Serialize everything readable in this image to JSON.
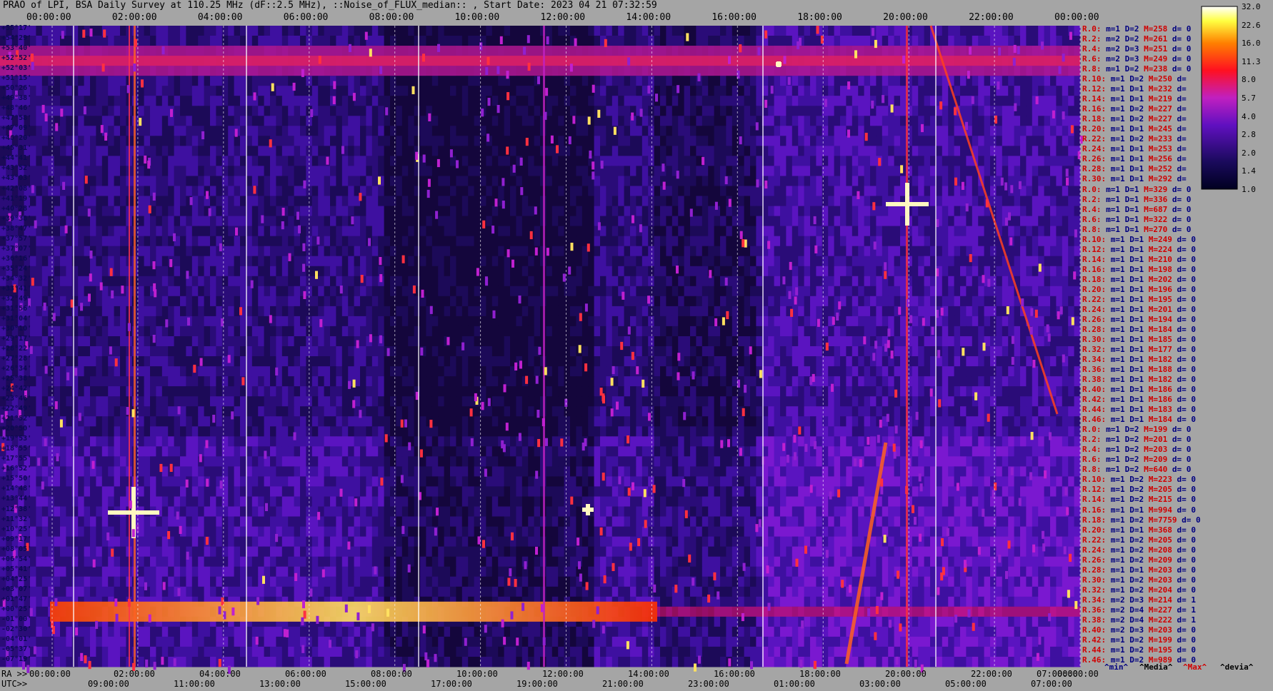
{
  "chart_data": {
    "type": "heatmap",
    "title": "PRAO of LPI, BSA Daily Survey at 110.25 MHz (dF::2.5 MHz), ::Noise_of_FLUX_median:: , Start Date: 2023 04 21 07:32:59",
    "colorbar": {
      "ticks": [
        "32.0",
        "22.6",
        "16.0",
        "11.3",
        "8.0",
        "5.7",
        "4.0",
        "2.8",
        "2.0",
        "1.4",
        "1.0"
      ],
      "range": [
        1.0,
        32.0
      ],
      "scale": "log"
    },
    "x_top_ticks": [
      "00:00:00",
      "02:00:00",
      "04:00:00",
      "06:00:00",
      "08:00:00",
      "10:00:00",
      "12:00:00",
      "14:00:00",
      "16:00:00",
      "18:00:00",
      "20:00:00",
      "22:00:00",
      "00:00:00"
    ],
    "x_bottom_ra_ticks": [
      "00:00:00",
      "02:00:00",
      "04:00:00",
      "06:00:00",
      "08:00:00",
      "10:00:00",
      "12:00:00",
      "14:00:00",
      "16:00:00",
      "18:00:00",
      "20:00:00",
      "22:00:00",
      "07:00:00",
      "00:00:00"
    ],
    "x_bottom_utc_ticks": [
      "09:00:00",
      "11:00:00",
      "13:00:00",
      "15:00:00",
      "17:00:00",
      "19:00:00",
      "21:00:00",
      "23:00:00",
      "01:00:00",
      "03:00:00",
      "05:00:00",
      "07:00:00"
    ],
    "x_bottom_ra_prefix": "RA >>",
    "x_bottom_utc_prefix": "UTC>>",
    "y_ticks": [
      "+55°17'",
      "+54°29'",
      "+53°40'",
      "+52°52'",
      "+52°03'",
      "+51°15'",
      "+50°26'",
      "+49°38'",
      "+48°46'",
      "+47°58'",
      "+47°09'",
      "+46°20'",
      "+45°31'",
      "+44°41'",
      "+43°52'",
      "+43°03'",
      "+42°08'",
      "+41°19'",
      "+40°28'",
      "+39°38'",
      "+38°47'",
      "+37°57'",
      "+37°07'",
      "+36°16'",
      "+35°24'",
      "+34°32'",
      "+33°41'",
      "+32°49'",
      "+31°56'",
      "+31°04'",
      "+30°10'",
      "+29°17'",
      "+28°22'",
      "+27°28'",
      "+26°34'",
      "+25°38'",
      "+24°42'",
      "+23°46'",
      "+22°49'",
      "+21°52'",
      "+20°50'",
      "+19°53'",
      "+18°55'",
      "+17°55'",
      "+16°52'",
      "+15°50'",
      "+14°48'",
      "+13°44'",
      "+12°38'",
      "+11°32'",
      "+10°25'",
      "+09°17'",
      "+08°05'",
      "+06°54'",
      "+05°41'",
      "+04°25'",
      "+03°07'",
      "+01°47'",
      "+00°25'",
      "-01°00'",
      "-02°30'",
      "-04°01'",
      "-05°37'",
      "-07°19'"
    ],
    "row_stats": [
      [
        "R.0:",
        "m=1",
        "D=2",
        "M=258",
        "d= 0"
      ],
      [
        "R.2:",
        "m=2",
        "D=2",
        "M=261",
        "d= 0"
      ],
      [
        "R.4:",
        "m=2",
        "D=3",
        "M=251",
        "d= 0"
      ],
      [
        "R.6:",
        "m=2",
        "D=3",
        "M=249",
        "d= 0"
      ],
      [
        "R.8:",
        "m=1",
        "D=2",
        "M=238",
        "d= 0"
      ],
      [
        "R.10:",
        "m=1",
        "D=2",
        "M=250",
        "d="
      ],
      [
        "R.12:",
        "m=1",
        "D=1",
        "M=232",
        "d="
      ],
      [
        "R.14:",
        "m=1",
        "D=1",
        "M=219",
        "d="
      ],
      [
        "R.16:",
        "m=1",
        "D=2",
        "M=227",
        "d="
      ],
      [
        "R.18:",
        "m=1",
        "D=2",
        "M=227",
        "d="
      ],
      [
        "R.20:",
        "m=1",
        "D=1",
        "M=245",
        "d="
      ],
      [
        "R.22:",
        "m=1",
        "D=2",
        "M=233",
        "d="
      ],
      [
        "R.24:",
        "m=1",
        "D=1",
        "M=253",
        "d="
      ],
      [
        "R.26:",
        "m=1",
        "D=1",
        "M=256",
        "d="
      ],
      [
        "R.28:",
        "m=1",
        "D=1",
        "M=252",
        "d="
      ],
      [
        "R.30:",
        "m=1",
        "D=1",
        "M=292",
        "d="
      ],
      [
        "R.0:",
        "m=1",
        "D=1",
        "M=329",
        "d= 0"
      ],
      [
        "R.2:",
        "m=1",
        "D=1",
        "M=336",
        "d= 0"
      ],
      [
        "R.4:",
        "m=1",
        "D=1",
        "M=687",
        "d= 0"
      ],
      [
        "R.6:",
        "m=1",
        "D=1",
        "M=322",
        "d= 0"
      ],
      [
        "R.8:",
        "m=1",
        "D=1",
        "M=270",
        "d= 0"
      ],
      [
        "R.10:",
        "m=1",
        "D=1",
        "M=249",
        "d= 0"
      ],
      [
        "R.12:",
        "m=1",
        "D=1",
        "M=224",
        "d= 0"
      ],
      [
        "R.14:",
        "m=1",
        "D=1",
        "M=210",
        "d= 0"
      ],
      [
        "R.16:",
        "m=1",
        "D=1",
        "M=198",
        "d= 0"
      ],
      [
        "R.18:",
        "m=1",
        "D=1",
        "M=202",
        "d= 0"
      ],
      [
        "R.20:",
        "m=1",
        "D=1",
        "M=196",
        "d= 0"
      ],
      [
        "R.22:",
        "m=1",
        "D=1",
        "M=195",
        "d= 0"
      ],
      [
        "R.24:",
        "m=1",
        "D=1",
        "M=201",
        "d= 0"
      ],
      [
        "R.26:",
        "m=1",
        "D=1",
        "M=194",
        "d= 0"
      ],
      [
        "R.28:",
        "m=1",
        "D=1",
        "M=184",
        "d= 0"
      ],
      [
        "R.30:",
        "m=1",
        "D=1",
        "M=185",
        "d= 0"
      ],
      [
        "R.32:",
        "m=1",
        "D=1",
        "M=177",
        "d= 0"
      ],
      [
        "R.34:",
        "m=1",
        "D=1",
        "M=182",
        "d= 0"
      ],
      [
        "R.36:",
        "m=1",
        "D=1",
        "M=188",
        "d= 0"
      ],
      [
        "R.38:",
        "m=1",
        "D=1",
        "M=182",
        "d= 0"
      ],
      [
        "R.40:",
        "m=1",
        "D=1",
        "M=186",
        "d= 0"
      ],
      [
        "R.42:",
        "m=1",
        "D=1",
        "M=186",
        "d= 0"
      ],
      [
        "R.44:",
        "m=1",
        "D=1",
        "M=183",
        "d= 0"
      ],
      [
        "R.46:",
        "m=1",
        "D=1",
        "M=184",
        "d= 0"
      ],
      [
        "R.0:",
        "m=1",
        "D=2",
        "M=199",
        "d= 0"
      ],
      [
        "R.2:",
        "m=1",
        "D=2",
        "M=201",
        "d= 0"
      ],
      [
        "R.4:",
        "m=1",
        "D=2",
        "M=203",
        "d= 0"
      ],
      [
        "R.6:",
        "m=1",
        "D=2",
        "M=209",
        "d= 0"
      ],
      [
        "R.8:",
        "m=1",
        "D=2",
        "M=640",
        "d= 0"
      ],
      [
        "R.10:",
        "m=1",
        "D=2",
        "M=223",
        "d= 0"
      ],
      [
        "R.12:",
        "m=1",
        "D=2",
        "M=205",
        "d= 0"
      ],
      [
        "R.14:",
        "m=1",
        "D=2",
        "M=215",
        "d= 0"
      ],
      [
        "R.16:",
        "m=1",
        "D=1",
        "M=994",
        "d= 0"
      ],
      [
        "R.18:",
        "m=1",
        "D=2",
        "M=7759",
        "d= 0"
      ],
      [
        "R.20:",
        "m=1",
        "D=1",
        "M=368",
        "d= 0"
      ],
      [
        "R.22:",
        "m=1",
        "D=2",
        "M=205",
        "d= 0"
      ],
      [
        "R.24:",
        "m=1",
        "D=2",
        "M=208",
        "d= 0"
      ],
      [
        "R.26:",
        "m=1",
        "D=2",
        "M=209",
        "d= 0"
      ],
      [
        "R.28:",
        "m=1",
        "D=1",
        "M=203",
        "d= 0"
      ],
      [
        "R.30:",
        "m=1",
        "D=2",
        "M=203",
        "d= 0"
      ],
      [
        "R.32:",
        "m=1",
        "D=2",
        "M=204",
        "d= 0"
      ],
      [
        "R.34:",
        "m=2",
        "D=3",
        "M=214",
        "d= 1"
      ],
      [
        "R.36:",
        "m=2",
        "D=4",
        "M=227",
        "d= 1"
      ],
      [
        "R.38:",
        "m=2",
        "D=4",
        "M=222",
        "d= 1"
      ],
      [
        "R.40:",
        "m=2",
        "D=3",
        "M=203",
        "d= 0"
      ],
      [
        "R.42:",
        "m=1",
        "D=2",
        "M=199",
        "d= 0"
      ],
      [
        "R.44:",
        "m=1",
        "D=2",
        "M=195",
        "d= 0"
      ],
      [
        "R.46:",
        "m=1",
        "D=2",
        "M=989",
        "d= 0"
      ]
    ],
    "footer_legend": [
      "^min^",
      "^Media^",
      "^Max^",
      "^devia^"
    ],
    "grid": true
  },
  "colors": {
    "background": "#a5a5a5",
    "dark": "#0a0530",
    "mid": "#5a0ca8",
    "bright": "#ff2010",
    "hot": "#ffff40"
  }
}
